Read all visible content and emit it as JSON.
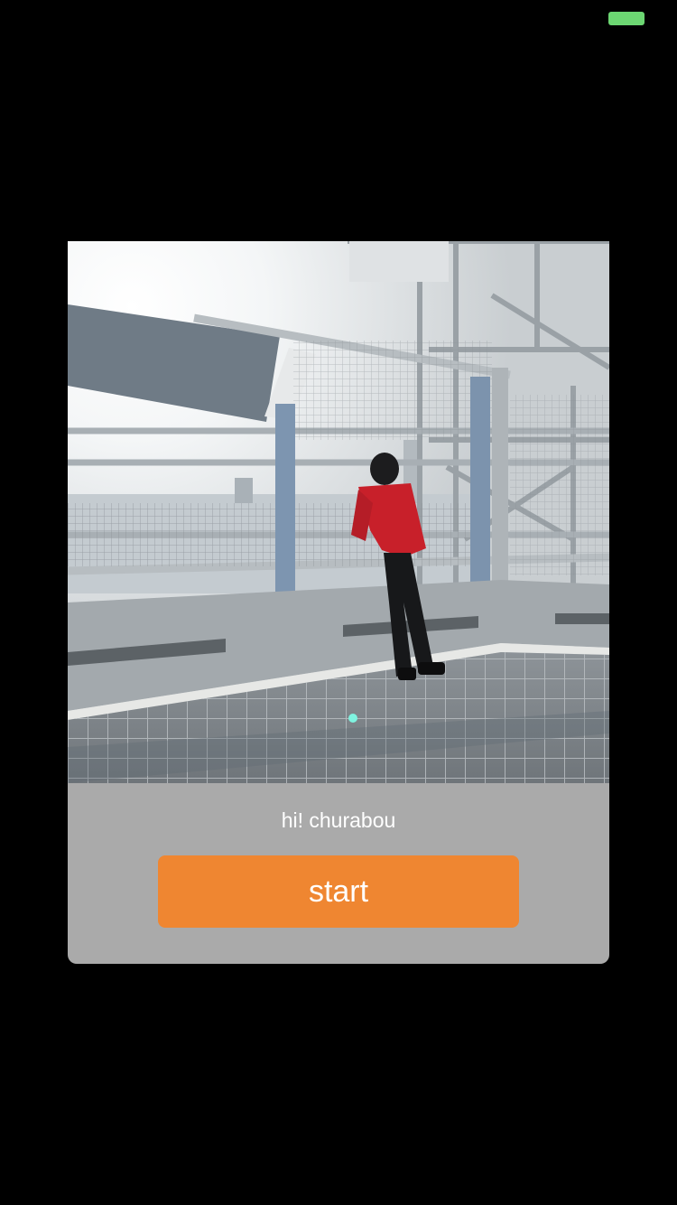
{
  "status_bar": {
    "battery_color": "#6cd672"
  },
  "card": {
    "background_color": "#aaaaaa",
    "photo": {
      "subject": "person in red shirt leaning on railing of observation deck"
    },
    "greeting": "hi! churabou",
    "start_button": {
      "label": "start",
      "color": "#ef8631"
    }
  }
}
